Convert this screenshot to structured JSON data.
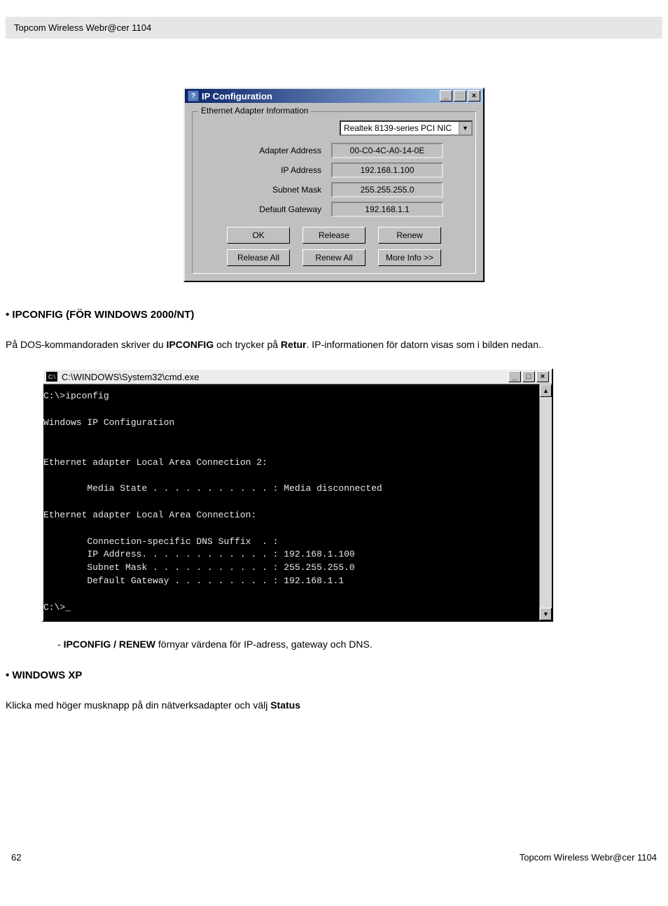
{
  "header": {
    "title": "Topcom Wireless Webr@cer 1104"
  },
  "ipcfg_dialog": {
    "title": "IP Configuration",
    "fieldset_label": "Ethernet  Adapter Information",
    "adapter_selected": "Realtek 8139-series PCI NIC",
    "rows": [
      {
        "label": "Adapter Address",
        "value": "00-C0-4C-A0-14-0E"
      },
      {
        "label": "IP Address",
        "value": "192.168.1.100"
      },
      {
        "label": "Subnet Mask",
        "value": "255.255.255.0"
      },
      {
        "label": "Default Gateway",
        "value": "192.168.1.1"
      }
    ],
    "buttons_row1": {
      "ok": "OK",
      "release": "Release",
      "renew": "Renew"
    },
    "buttons_row2": {
      "release_all": "Release All",
      "renew_all": "Renew All",
      "more_info": "More Info >>"
    }
  },
  "section1": {
    "heading": "• IPCONFIG (FÖR WINDOWS 2000/NT)",
    "para_pre": "På DOS-kommandoraden skriver du ",
    "para_b1": "IPCONFIG",
    "para_mid": " och trycker på ",
    "para_b2": "Retur",
    "para_post": ". IP-informationen för datorn visas som i bilden nedan.",
    "dot": "."
  },
  "cmd_window": {
    "title": "C:\\WINDOWS\\System32\\cmd.exe",
    "content": "C:\\>ipconfig\n\nWindows IP Configuration\n\n\nEthernet adapter Local Area Connection 2:\n\n        Media State . . . . . . . . . . . : Media disconnected\n\nEthernet adapter Local Area Connection:\n\n        Connection-specific DNS Suffix  . :\n        IP Address. . . . . . . . . . . . : 192.168.1.100\n        Subnet Mask . . . . . . . . . . . : 255.255.255.0\n        Default Gateway . . . . . . . . . : 192.168.1.1\n\nC:\\>_"
  },
  "sub_bullet": {
    "prefix": "- ",
    "bold": "IPCONFIG / RENEW",
    "rest": " förnyar värdena för IP-adress, gateway och DNS."
  },
  "section2": {
    "heading": "• WINDOWS XP",
    "para_pre": "Klicka med höger musknapp på din nätverksadapter och välj ",
    "para_bold": "Status"
  },
  "footer": {
    "page": "62",
    "brand": "Topcom Wireless Webr@cer 1104"
  }
}
